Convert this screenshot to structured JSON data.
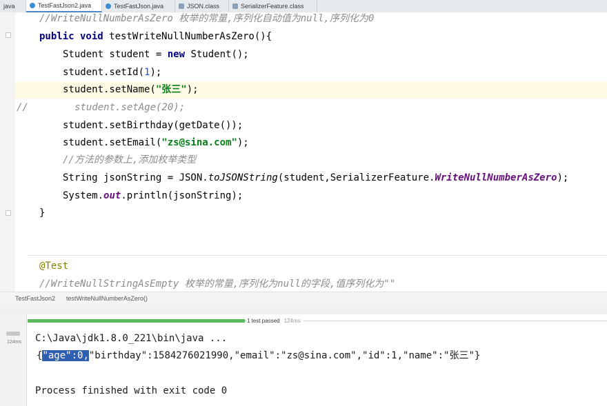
{
  "tabs": [
    {
      "label": "java",
      "icon": "none",
      "active": false
    },
    {
      "label": "TestFastJson2.java",
      "icon": "java-class-icon",
      "active": true
    },
    {
      "label": "TestFastJson.java",
      "icon": "java-class-icon",
      "active": false
    },
    {
      "label": "JSON.class",
      "icon": "class-file-icon",
      "active": false
    },
    {
      "label": "SerializerFeature.class",
      "icon": "class-file-icon",
      "active": false
    }
  ],
  "code": {
    "comment_top": "//WriteNullNumberAsZero 枚举的常量,序列化自动值为null,序列化为0",
    "method_kw": "public void",
    "method_sig": " testWriteNullNumberAsZero(){",
    "line_student_a": "Student student = ",
    "line_student_new": "new",
    "line_student_b": " Student();",
    "setid_a": "student.setId(",
    "setid_num": "1",
    "setid_b": ");",
    "setname_a": "student.setName(",
    "setname_str": "\"张三\"",
    "setname_b": ");",
    "commented_prefix": "//",
    "commented_code": "student.setAge(20);",
    "setbirthday": "student.setBirthday(getDate());",
    "setemail_a": "student.setEmail(",
    "setemail_str": "\"zs@sina.com\"",
    "setemail_b": ");",
    "comment_enum": "//方法的参数上,添加枚举类型",
    "json_a": "String jsonString = JSON.",
    "json_method": "toJSONString",
    "json_b": "(student,SerializerFeature.",
    "json_enum": "WriteNullNumberAsZero",
    "json_c": ");",
    "print_a": "System.",
    "print_out": "out",
    "print_b": ".println(jsonString);",
    "close_brace": "}",
    "annotation": "@Test",
    "comment_bottom": "//WriteNullStringAsEmpty 枚举的常量,序列化为null的字段,值序列化为\"\""
  },
  "breadcrumb": [
    "TestFastJson2",
    "testWriteNullNumberAsZero()"
  ],
  "run": {
    "status": "1 test passed",
    "status_time": "124ms",
    "side_time": "124ms",
    "cmd": "C:\\Java\\jdk1.8.0_221\\bin\\java ...",
    "output_open": "{",
    "output_selected": "\"age\":0,",
    "output_rest": "\"birthday\":1584276021990,\"email\":\"zs@sina.com\",\"id\":1,\"name\":\"张三\"}",
    "exit": "Process finished with exit code 0"
  },
  "colors": {
    "keyword": "#000080",
    "string": "#067d17",
    "number": "#1750eb",
    "static_field": "#660e7a",
    "comment": "#8c8c8c",
    "annotation": "#808000",
    "selection": "#2f5fb0",
    "test_passed": "#5cb85c"
  }
}
